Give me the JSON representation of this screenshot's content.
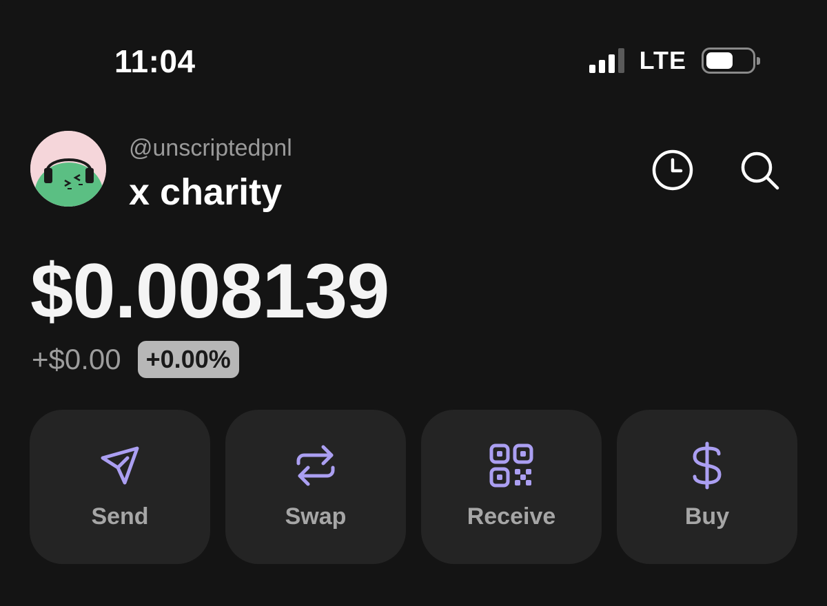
{
  "status_bar": {
    "time": "11:04",
    "network": "LTE",
    "signal_bars": 3,
    "signal_total": 4,
    "battery_level": 0.6
  },
  "account": {
    "handle": "@unscriptedpnl",
    "name": "x charity",
    "icons": [
      "history-icon",
      "search-icon"
    ]
  },
  "balance": {
    "value": "$0.008139",
    "change_amount": "+$0.00",
    "change_percent": "+0.00%"
  },
  "actions": [
    {
      "label": "Send",
      "icon": "send-icon"
    },
    {
      "label": "Swap",
      "icon": "swap-icon"
    },
    {
      "label": "Receive",
      "icon": "qr-code-icon"
    },
    {
      "label": "Buy",
      "icon": "dollar-icon"
    }
  ],
  "colors": {
    "background": "#141414",
    "card": "#242424",
    "accent": "#ab9ff2",
    "muted_text": "#9d9d9d",
    "avatar_bg": "#f5d6da",
    "avatar_green": "#5bbf83"
  }
}
